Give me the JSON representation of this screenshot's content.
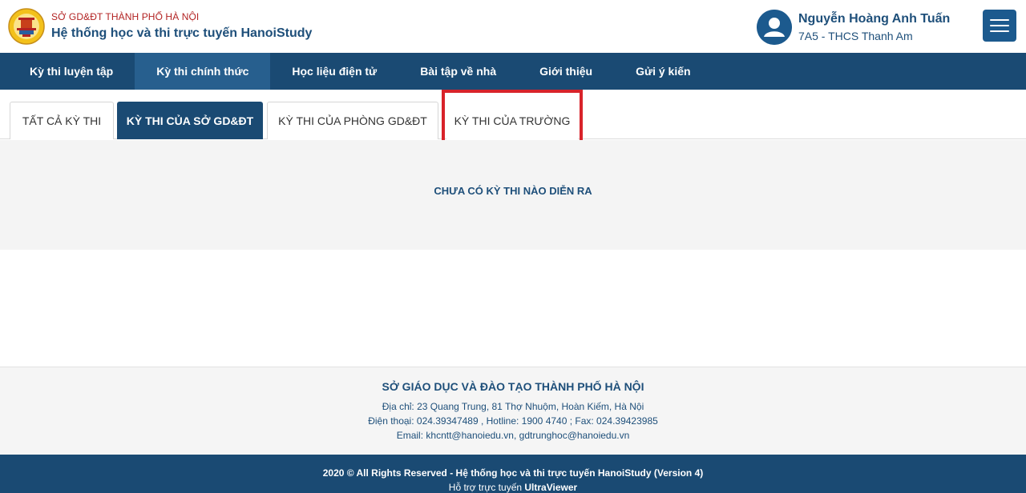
{
  "header": {
    "org_name": "SỞ GD&ĐT THÀNH PHỐ HÀ NỘI",
    "system_name": "Hệ thống học và thi trực tuyến HanoiStudy",
    "user_name": "Nguyễn Hoàng Anh Tuấn",
    "user_class": "7A5 - THCS Thanh Am",
    "icons": {
      "logo": "emblem-logo",
      "avatar": "user-icon",
      "menu": "hamburger-menu-icon"
    }
  },
  "nav": {
    "items": [
      {
        "label": "Kỳ thi luyện tập"
      },
      {
        "label": "Kỳ thi chính thức"
      },
      {
        "label": "Học liệu điện tử"
      },
      {
        "label": "Bài tập về nhà"
      },
      {
        "label": "Giới thiệu"
      },
      {
        "label": "Gửi ý kiến"
      }
    ],
    "active_index": 1
  },
  "tabs": {
    "items": [
      {
        "label": "TẤT CẢ KỲ THI"
      },
      {
        "label": "KỲ THI CỦA SỞ GD&ĐT"
      },
      {
        "label": "KỲ THI CỦA PHÒNG GD&ĐT"
      },
      {
        "label": "KỲ THI CỦA TRƯỜNG"
      }
    ],
    "active_index": 1,
    "highlighted_index": 3
  },
  "content": {
    "empty_message": "CHƯA CÓ KỲ THI NÀO DIỄN RA"
  },
  "footer": {
    "title": "SỞ GIÁO DỤC VÀ ĐÀO TẠO THÀNH PHỐ HÀ NỘI",
    "address": "Địa chỉ: 23 Quang Trung, 81 Thợ Nhuộm, Hoàn Kiếm, Hà Nội",
    "phone": "Điện thoại: 024.39347489 , Hotline: 1900 4740 ; Fax: 024.39423985",
    "email": "Email: khcntt@hanoiedu.vn, gdtrunghoc@hanoiedu.vn",
    "copyright": "2020 © All Rights Reserved - Hệ thống học và thi trực tuyến HanoiStudy (Version 4)",
    "support_prefix": "Hỗ trợ trực tuyến",
    "support_link": "UltraViewer"
  },
  "colors": {
    "primary": "#1a4a73",
    "nav_active": "#275f8e",
    "text_blue": "#1e4f7a",
    "org_red": "#b22222",
    "highlight_red": "#d8232a"
  }
}
